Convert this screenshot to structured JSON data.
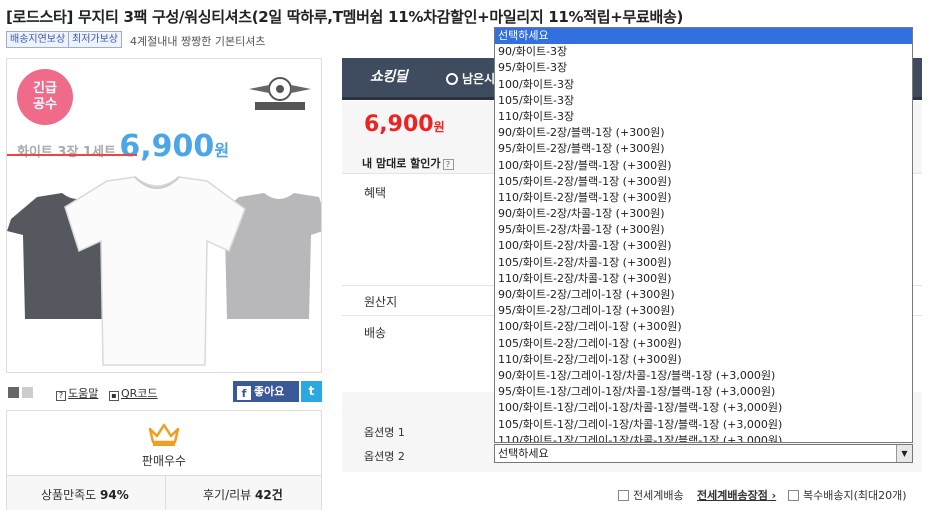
{
  "product": {
    "title": "[로드스타] 무지티 3팩 구성/워싱티셔츠(2일 딱하루,T멤버쉽 11%차감할인+마일리지 11%적립+무료배송)",
    "badges": [
      "배송지연보상",
      "최저가보상"
    ],
    "subtitle": "4계절내내 짱짱한 기본티셔츠"
  },
  "image": {
    "urgent_line1": "긴급",
    "urgent_line2": "공수",
    "price_text": "화이트 3장 1세트",
    "price_value": "6,900",
    "price_unit": "원",
    "logo_text": "ROADSTAR MAN"
  },
  "links": {
    "help": "도움말",
    "qr": "QR코드",
    "facebook": "좋아요",
    "twitter": "t"
  },
  "award": {
    "label": "판매우수"
  },
  "stats": {
    "satisfaction_label": "상품만족도",
    "satisfaction_value": "94%",
    "review_label": "후기/리뷰",
    "review_value": "42건"
  },
  "deal": {
    "brand": "쇼킹딜",
    "remain": "남은시"
  },
  "price": {
    "value": "6,900",
    "unit": "원",
    "discount_label": "내 맘대로 할인가",
    "help_mark": "?"
  },
  "rows": {
    "benefit": "혜택",
    "origin": "원산지",
    "shipping": "배송",
    "option1": "옵션명 1",
    "option2": "옵션명 2"
  },
  "select": {
    "placeholder": "선택하세요",
    "arrow": "▼"
  },
  "dropdown_options": [
    "선택하세요",
    "90/화이트-3장",
    "95/화이트-3장",
    "100/화이트-3장",
    "105/화이트-3장",
    "110/화이트-3장",
    "90/화이트-2장/블랙-1장 (+300원)",
    "95/화이트-2장/블랙-1장 (+300원)",
    "100/화이트-2장/블랙-1장 (+300원)",
    "105/화이트-2장/블랙-1장 (+300원)",
    "110/화이트-2장/블랙-1장 (+300원)",
    "90/화이트-2장/차콜-1장 (+300원)",
    "95/화이트-2장/차콜-1장 (+300원)",
    "100/화이트-2장/차콜-1장 (+300원)",
    "105/화이트-2장/차콜-1장 (+300원)",
    "110/화이트-2장/차콜-1장 (+300원)",
    "90/화이트-2장/그레이-1장 (+300원)",
    "95/화이트-2장/그레이-1장 (+300원)",
    "100/화이트-2장/그레이-1장 (+300원)",
    "105/화이트-2장/그레이-1장 (+300원)",
    "110/화이트-2장/그레이-1장 (+300원)",
    "90/화이트-1장/그레이-1장/차콜-1장/블랙-1장 (+3,000원)",
    "95/화이트-1장/그레이-1장/차콜-1장/블랙-1장 (+3,000원)",
    "100/화이트-1장/그레이-1장/차콜-1장/블랙-1장 (+3,000원)",
    "105/화이트-1장/그레이-1장/차콜-1장/블랙-1장 (+3,000원)",
    "110/화이트-1장/그레이-1장/차콜-1장/블랙-1장 (+3,000원)"
  ],
  "footer": {
    "global_shipping": "전세계배송",
    "global_shipping_info": "전세계배송장점",
    "multi_address": "복수배송지(최대20개)"
  },
  "colors": {
    "accent_red": "#e22222",
    "accent_blue": "#4aa6e6",
    "dark_bar": "#3f4b5e",
    "selected_option": "#3270e0"
  }
}
